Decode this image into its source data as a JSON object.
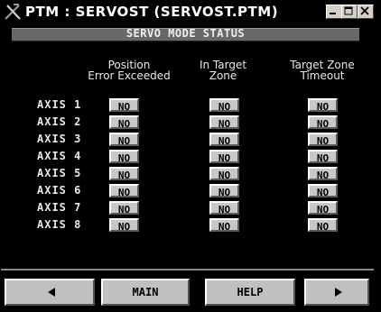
{
  "window": {
    "title": "PTM : SERVOST (SERVOST.PTM)"
  },
  "header": {
    "title": "SERVO MODE STATUS"
  },
  "columns": [
    {
      "line1": "Position",
      "line2": "Error Exceeded"
    },
    {
      "line1": "In Target",
      "line2": "Zone"
    },
    {
      "line1": "Target Zone",
      "line2": "Timeout"
    }
  ],
  "axes": [
    {
      "label": "AXIS 1",
      "values": [
        "NO",
        "NO",
        "NO"
      ]
    },
    {
      "label": "AXIS 2",
      "values": [
        "NO",
        "NO",
        "NO"
      ]
    },
    {
      "label": "AXIS 3",
      "values": [
        "NO",
        "NO",
        "NO"
      ]
    },
    {
      "label": "AXIS 4",
      "values": [
        "NO",
        "NO",
        "NO"
      ]
    },
    {
      "label": "AXIS 5",
      "values": [
        "NO",
        "NO",
        "NO"
      ]
    },
    {
      "label": "AXIS 6",
      "values": [
        "NO",
        "NO",
        "NO"
      ]
    },
    {
      "label": "AXIS 7",
      "values": [
        "NO",
        "NO",
        "NO"
      ]
    },
    {
      "label": "AXIS 8",
      "values": [
        "NO",
        "NO",
        "NO"
      ]
    }
  ],
  "nav": {
    "prev_icon": "left-arrow-icon",
    "main_label": "MAIN",
    "help_label": "HELP",
    "next_icon": "right-arrow-icon"
  },
  "colors": {
    "background": "#000000",
    "button_face": "#c8c8c8",
    "header_bar": "#686868"
  }
}
